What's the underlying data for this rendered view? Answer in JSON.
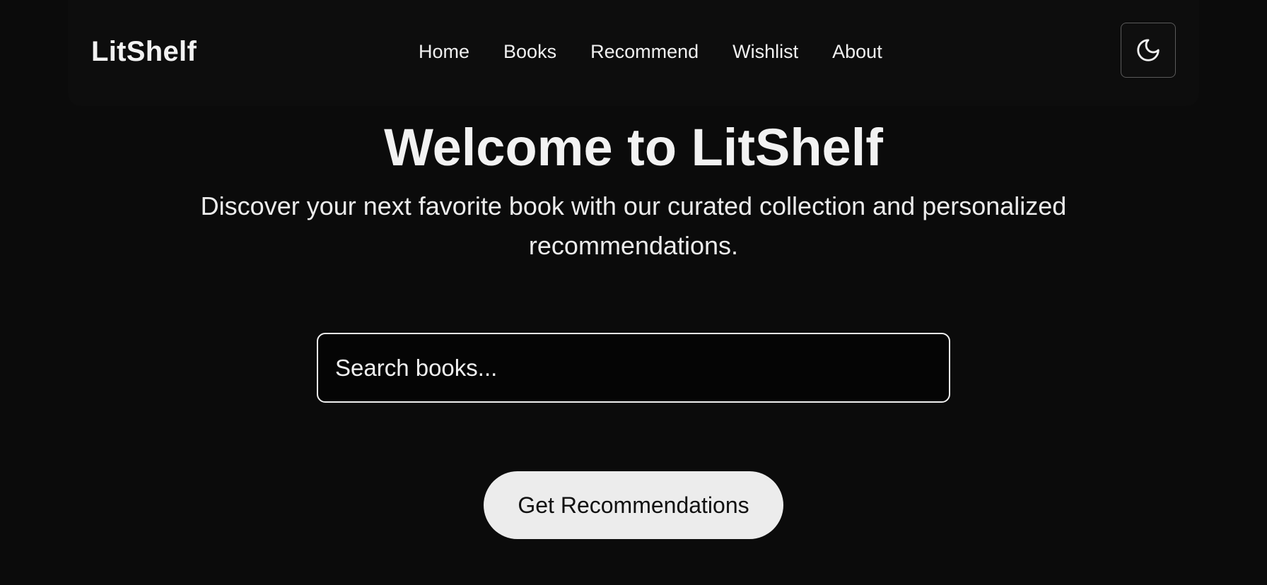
{
  "app": {
    "brand": "LitShelf"
  },
  "nav": {
    "links": [
      "Home",
      "Books",
      "Recommend",
      "Wishlist",
      "About"
    ],
    "theme_toggle_icon": "moon-icon"
  },
  "hero": {
    "title": "Welcome to LitShelf",
    "subtitle": "Discover your next favorite book with our curated collection and personalized recommendations."
  },
  "search": {
    "placeholder": "Search books...",
    "value": ""
  },
  "cta": {
    "label": "Get Recommendations"
  },
  "colors": {
    "background": "#0b0b0b",
    "text": "#f0f0f0",
    "button_bg": "#ececec",
    "button_text": "#111111"
  }
}
